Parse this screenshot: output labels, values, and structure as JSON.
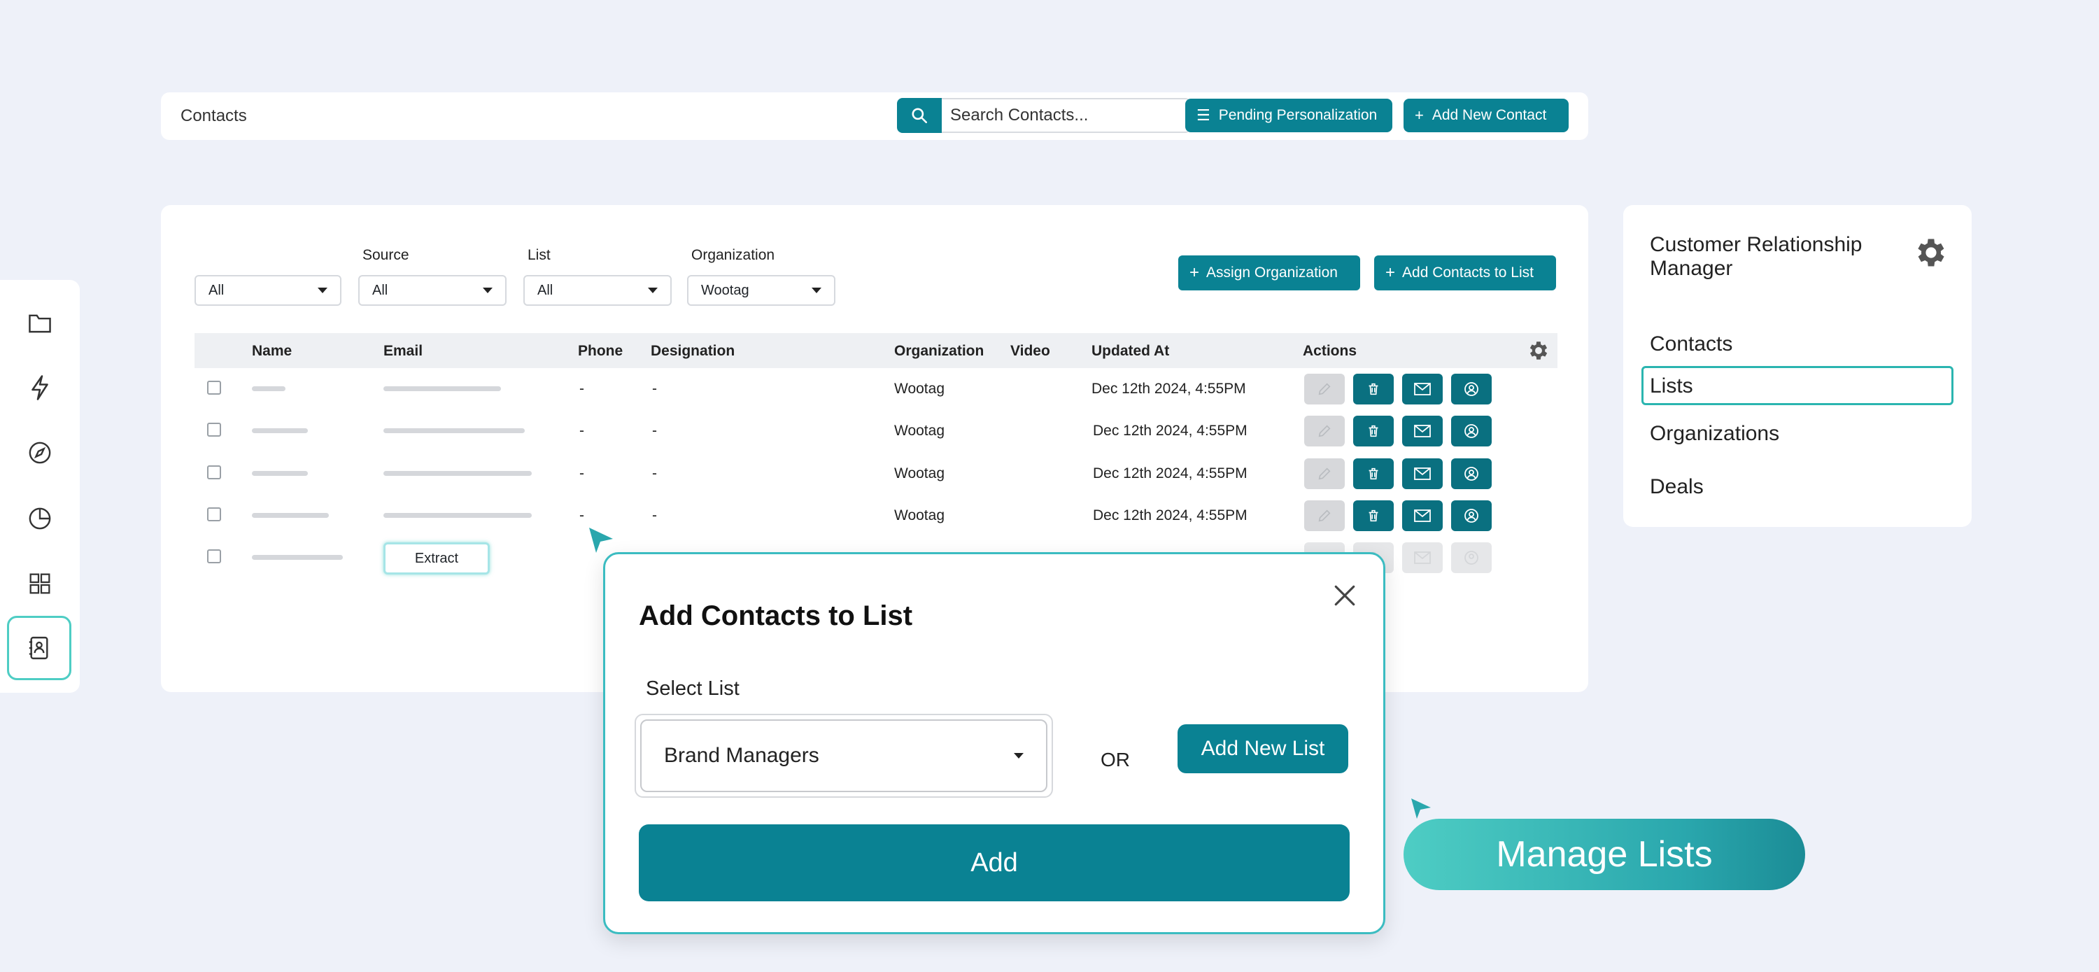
{
  "colors": {
    "accent": "#0a8293",
    "accent_dark": "#0a7080",
    "highlight": "#4ecdc4",
    "background": "#eef1f9"
  },
  "topbar": {
    "title": "Contacts",
    "search_placeholder": "Search Contacts...",
    "pending_label": "Pending Personalization",
    "add_contact_label": "Add New Contact"
  },
  "filters": {
    "first": {
      "label": "",
      "value": "All"
    },
    "source": {
      "label": "Source",
      "value": "All"
    },
    "list": {
      "label": "List",
      "value": "All"
    },
    "organization": {
      "label": "Organization",
      "value": "Wootag"
    },
    "assign_label": "Assign Organization",
    "add_to_list_label": "Add Contacts to List"
  },
  "table": {
    "columns": [
      "Name",
      "Email",
      "Phone",
      "Designation",
      "Organization",
      "Video",
      "Updated At",
      "Actions"
    ],
    "rows": [
      {
        "phone": "-",
        "designation": "-",
        "organization": "Wootag",
        "updated_at": "Dec 12th 2024, 4:55PM"
      },
      {
        "phone": "-",
        "designation": "-",
        "organization": "Wootag",
        "updated_at": "Dec 12th 2024, 4:55PM"
      },
      {
        "phone": "-",
        "designation": "-",
        "organization": "Wootag",
        "updated_at": "Dec 12th 2024, 4:55PM"
      },
      {
        "phone": "-",
        "designation": "-",
        "organization": "Wootag",
        "updated_at": "Dec 12th 2024, 4:55PM"
      },
      {
        "phone": "-"
      }
    ],
    "extract_label": "Extract"
  },
  "sidebar": {
    "icons": [
      "folder-icon",
      "lightning-icon",
      "compass-icon",
      "pie-chart-icon",
      "grid-icon",
      "contacts-book-icon"
    ],
    "active": "contacts-book-icon"
  },
  "right_panel": {
    "title": "Customer Relationship Manager",
    "items": [
      "Contacts",
      "Lists",
      "Organizations",
      "Deals"
    ],
    "selected": "Lists"
  },
  "modal": {
    "title": "Add Contacts to List",
    "select_label": "Select List",
    "selected_value": "Brand Managers",
    "or_text": "OR",
    "add_new_list_label": "Add New List",
    "add_label": "Add"
  },
  "callout": {
    "label": "Manage Lists"
  }
}
